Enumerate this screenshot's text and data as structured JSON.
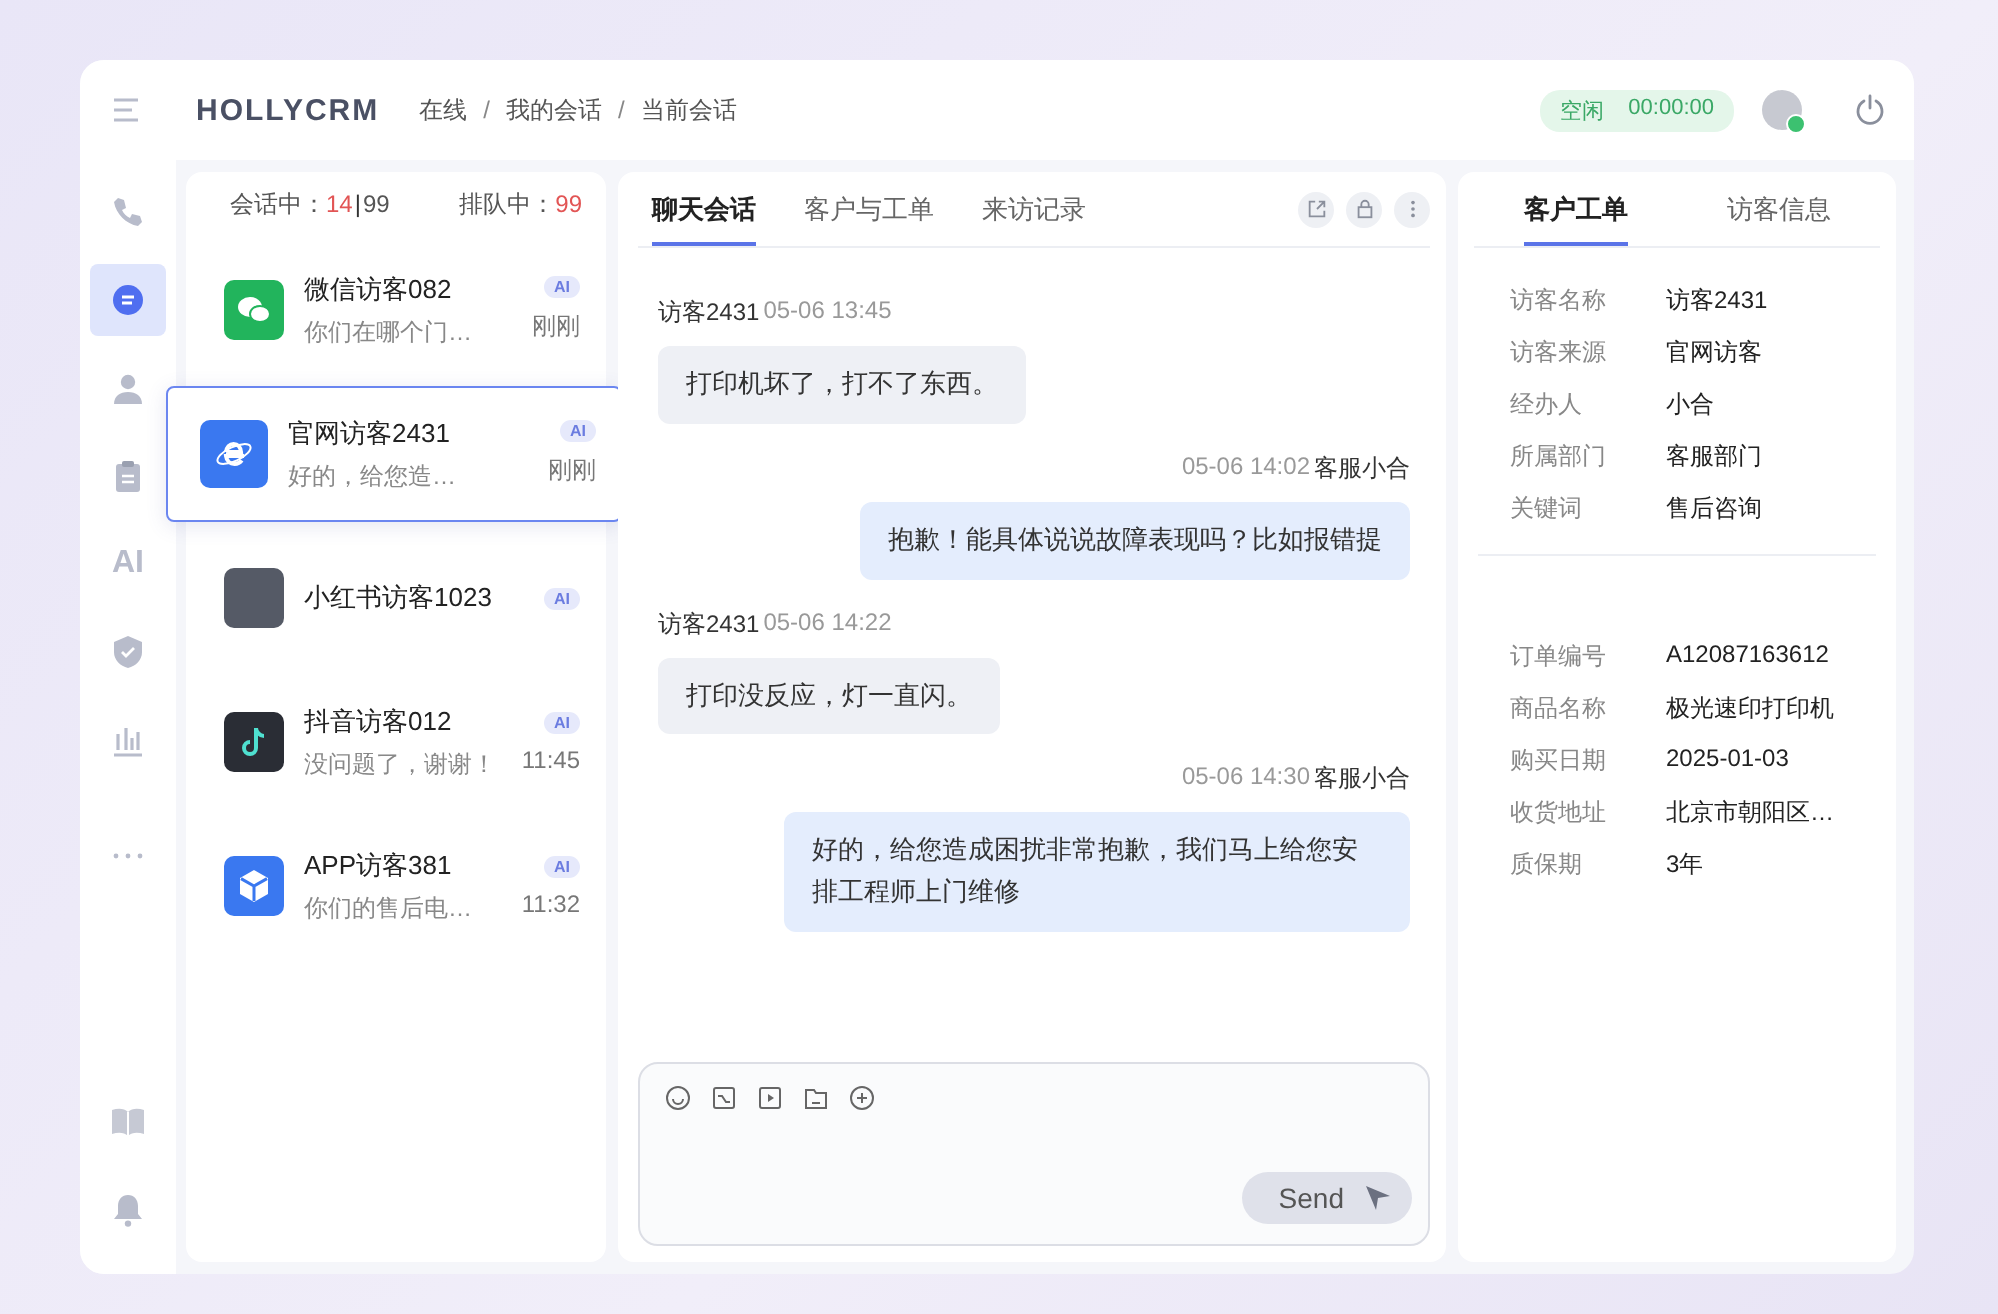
{
  "header": {
    "logo": "HOLLYCRM",
    "breadcrumb": [
      "在线",
      "我的会话",
      "当前会话"
    ],
    "separator": "/",
    "status": {
      "label": "空闲",
      "timer": "00:00:00"
    }
  },
  "nav": [
    {
      "kind": "phone",
      "selected": false
    },
    {
      "kind": "chat",
      "selected": true
    },
    {
      "kind": "user",
      "selected": false
    },
    {
      "kind": "clipboard",
      "selected": false
    },
    {
      "kind": "text",
      "label": "AI",
      "selected": false
    },
    {
      "kind": "shield",
      "selected": false
    },
    {
      "kind": "chart",
      "selected": false
    },
    {
      "kind": "dots",
      "selected": false
    },
    {
      "kind": "book",
      "selected": false
    },
    {
      "kind": "bell",
      "selected": false
    }
  ],
  "counters": {
    "active_label": "会话中：",
    "active": "14",
    "divider": "|",
    "total": "99",
    "queue_label": "排队中：",
    "queue": "99"
  },
  "conversations": [
    {
      "kind": "wechat",
      "name": "微信访客082",
      "badge": "AI",
      "preview": "你们在哪个门…",
      "time": "刚刚",
      "selected": false
    },
    {
      "kind": "web",
      "name": "官网访客2431",
      "badge": "AI",
      "preview": "好的，给您造…",
      "time": "刚刚",
      "selected": true
    },
    {
      "kind": "note",
      "name": "小红书访客1023",
      "badge": "AI",
      "selected": false
    },
    {
      "kind": "music",
      "name": "抖音访客012",
      "badge": "AI",
      "preview": "没问题了，谢谢！",
      "time": "11:45",
      "selected": false
    },
    {
      "kind": "app",
      "name": "APP访客381",
      "badge": "AI",
      "preview": "你们的售后电…",
      "time": "11:32",
      "selected": false
    }
  ],
  "chat_tabs": [
    {
      "label": "聊天会话",
      "selected": true
    },
    {
      "label": "客户与工单",
      "selected": false
    },
    {
      "label": "来访记录",
      "selected": false
    }
  ],
  "messages": [
    {
      "kind": "incoming",
      "sender": "访客2431",
      "time": "05-06 13:45",
      "text": "打印机坏了，打不了东西。"
    },
    {
      "kind": "outgoing",
      "sender": "客服小合",
      "time": "05-06 14:02",
      "text": "抱歉！能具体说说故障表现吗？比如报错提"
    },
    {
      "kind": "incoming",
      "sender": "访客2431",
      "time": "05-06 14:22",
      "text": "打印没反应，灯一直闪。"
    },
    {
      "kind": "outgoing",
      "sender": "客服小合",
      "time": "05-06 14:30",
      "text": "好的，给您造成困扰非常抱歉，我们马上给您安排工程师上门维修"
    }
  ],
  "composer": {
    "send": "Send"
  },
  "info_tabs": [
    {
      "label": "客户工单",
      "selected": true
    },
    {
      "label": "访客信息",
      "selected": false
    }
  ],
  "customer_fields": [
    {
      "label": "访客名称",
      "value": "访客2431"
    },
    {
      "label": "访客来源",
      "value": "官网访客"
    },
    {
      "label": "经办人",
      "value": "小合"
    },
    {
      "label": "所属部门",
      "value": "客服部门"
    },
    {
      "label": "关键词",
      "value": "售后咨询"
    }
  ],
  "order_fields": [
    {
      "label": "订单编号",
      "value": "A12087163612"
    },
    {
      "label": "商品名称",
      "value": "极光速印打印机"
    },
    {
      "label": "购买日期",
      "value": "2025-01-03"
    },
    {
      "label": "收货地址",
      "value": "北京市朝阳区…"
    },
    {
      "label": "质保期",
      "value": "3年"
    }
  ]
}
